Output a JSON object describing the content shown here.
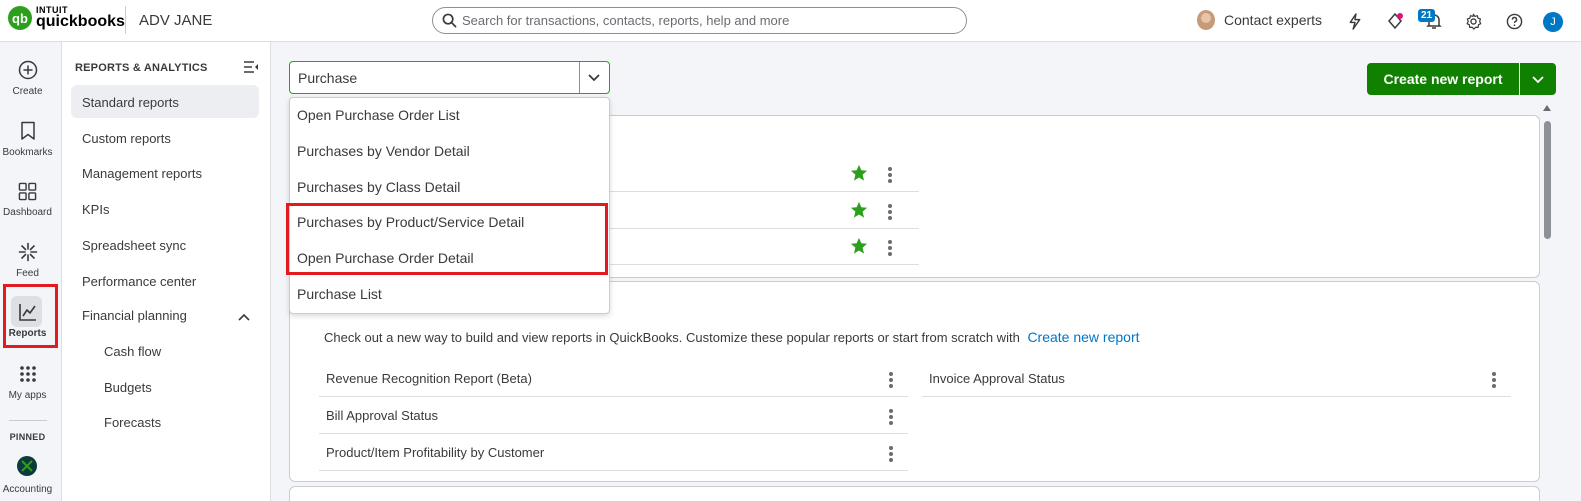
{
  "header": {
    "logo_intuit": "INTUIT",
    "logo_product": "quickbooks",
    "company": "ADV JANE",
    "search_placeholder": "Search for transactions, contacts, reports, help and more",
    "contact_label": "Contact experts",
    "notifications_count": "21",
    "user_initial": "J"
  },
  "rail": {
    "items": [
      {
        "label": "Create",
        "icon": "plus-circle-icon"
      },
      {
        "label": "Bookmarks",
        "icon": "bookmark-icon"
      },
      {
        "label": "Dashboard",
        "icon": "dashboard-icon"
      },
      {
        "label": "Feed",
        "icon": "feed-icon"
      },
      {
        "label": "Reports",
        "icon": "chart-line-icon"
      },
      {
        "label": "My apps",
        "icon": "apps-grid-icon"
      }
    ],
    "pinned_label": "PINNED",
    "pinned_item": "Accounting",
    "active": "Reports"
  },
  "subnav": {
    "heading": "REPORTS & ANALYTICS",
    "items": [
      "Standard reports",
      "Custom reports",
      "Management reports",
      "KPIs",
      "Spreadsheet sync",
      "Performance center",
      "Financial planning"
    ],
    "sub_items": [
      "Cash flow",
      "Budgets",
      "Forecasts"
    ],
    "active": "Standard reports"
  },
  "main": {
    "search_value": "Purchase",
    "create_button": "Create new report",
    "dropdown": [
      "Open Purchase Order List",
      "Purchases by Vendor Detail",
      "Purchases by Class Detail",
      "Purchases by Product/Service Detail",
      "Open Purchase Order Detail",
      "Purchase List"
    ],
    "card2": {
      "intro": "Check out a new way to build and view reports in QuickBooks. Customize these popular reports or start from scratch with",
      "intro_link": "Create new report",
      "left_reports": [
        "Revenue Recognition Report (Beta)",
        "Bill Approval Status",
        "Product/Item Profitability by Customer"
      ],
      "right_reports": [
        "Invoice Approval Status"
      ]
    }
  },
  "colors": {
    "brand_green": "#2ca01c",
    "button_green": "#108000",
    "link_blue": "#0077c5",
    "highlight_red": "#e21b23"
  }
}
